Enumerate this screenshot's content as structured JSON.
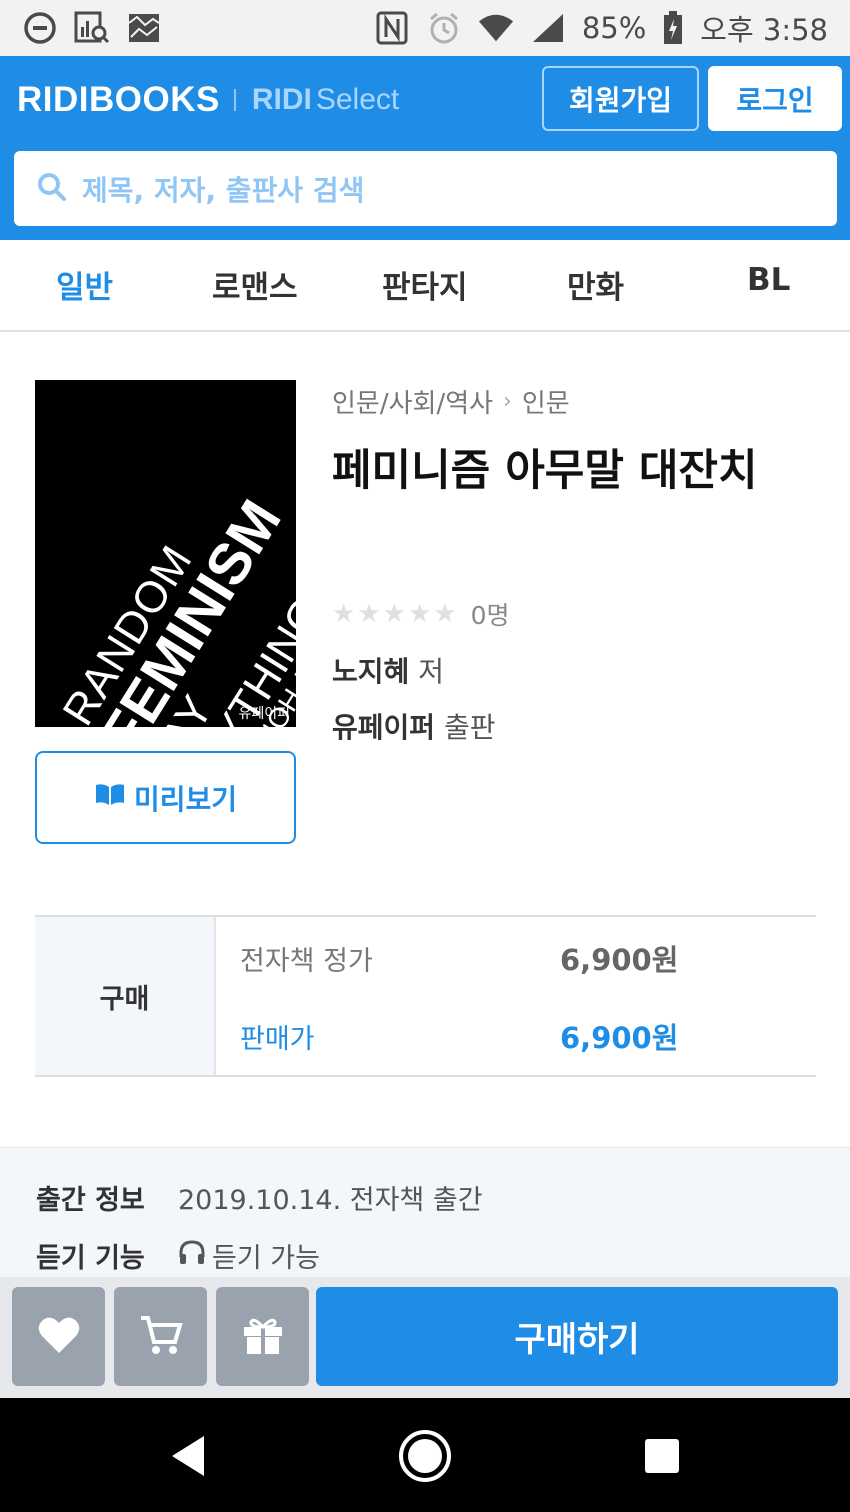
{
  "status_bar": {
    "icons_left": [
      "circle-minus-icon",
      "search-stats-icon",
      "image-icon"
    ],
    "icons_right": [
      "nfc-icon",
      "alarm-icon",
      "wifi-icon",
      "signal-icon"
    ],
    "battery": "85%",
    "time": "오후 3:58"
  },
  "header": {
    "brand": "RIDIBOOKS",
    "select_brand_bold": "RIDI",
    "select_brand_light": "Select",
    "signup_label": "회원가입",
    "login_label": "로그인",
    "search_placeholder": "제목, 저자, 출판사 검색",
    "accent_color": "#1f8ce6"
  },
  "tabs": [
    {
      "label": "일반",
      "active": true
    },
    {
      "label": "로맨스",
      "active": false
    },
    {
      "label": "판타지",
      "active": false
    },
    {
      "label": "만화",
      "active": false
    },
    {
      "label": "BL",
      "active": false
    }
  ],
  "book": {
    "cover": {
      "line1": "RANDOM",
      "line2": "FEMINISM",
      "line3": "SAY ANYTHING",
      "line4": "NOH JI HYE",
      "publisher": "유페이퍼"
    },
    "preview_label": "미리보기",
    "breadcrumb": [
      "인문/사회/역사",
      "인문"
    ],
    "title": "페미니즘 아무말 대잔치",
    "rating": 0,
    "rating_count": "0명",
    "author": "노지혜",
    "author_suffix": "저",
    "publisher": "유페이퍼",
    "publisher_suffix": "출판"
  },
  "price": {
    "section_label": "구매",
    "list_price_label": "전자책 정가",
    "list_price": "6,900원",
    "sale_price_label": "판매가",
    "sale_price": "6,900원"
  },
  "info": {
    "release_key": "출간 정보",
    "release_value": "2019.10.14. 전자책 출간",
    "listen_key": "듣기 기능",
    "listen_value": "듣기 가능"
  },
  "actions": {
    "icons": [
      "heart-icon",
      "cart-icon",
      "gift-icon"
    ],
    "buy_label": "구매하기"
  }
}
